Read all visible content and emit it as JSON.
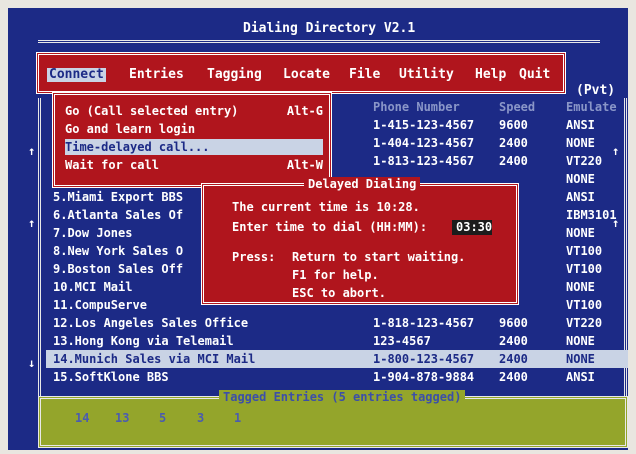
{
  "window": {
    "title": "Dialing Directory V2.1"
  },
  "menubar": {
    "items": [
      {
        "label": "Connect"
      },
      {
        "label": "Entries"
      },
      {
        "label": "Tagging"
      },
      {
        "label": "Locate"
      },
      {
        "label": "File"
      },
      {
        "label": "Utility"
      },
      {
        "label": "Help"
      },
      {
        "label": "Quit"
      }
    ]
  },
  "connect_menu": {
    "items": [
      {
        "label": "Go (Call selected entry)",
        "shortcut": "Alt-G"
      },
      {
        "label": "Go and learn login",
        "shortcut": ""
      },
      {
        "label": "Time-delayed call...",
        "shortcut": ""
      },
      {
        "label": "Wait for call",
        "shortcut": "Alt-W"
      }
    ]
  },
  "list": {
    "header": {
      "pvt": "(Pvt)",
      "phone": "Phone Number",
      "speed": "Speed",
      "emulate": "Emulate"
    },
    "rows": [
      {
        "name": "",
        "phone": "1-415-123-4567",
        "speed": "9600",
        "emu": "ANSI"
      },
      {
        "name": "",
        "phone": "1-404-123-4567",
        "speed": "2400",
        "emu": "NONE"
      },
      {
        "name": "",
        "phone": "1-813-123-4567",
        "speed": "2400",
        "emu": "VT220"
      },
      {
        "name": "",
        "phone": "",
        "speed": "",
        "emu": "NONE"
      },
      {
        "name": "5.Miami Export BBS",
        "phone": "",
        "speed": "",
        "emu": "ANSI"
      },
      {
        "name": "6.Atlanta Sales Of",
        "phone": "",
        "speed": "",
        "emu": "IBM3101"
      },
      {
        "name": "7.Dow Jones",
        "phone": "",
        "speed": "",
        "emu": "NONE"
      },
      {
        "name": "8.New York Sales O",
        "phone": "",
        "speed": "",
        "emu": "VT100"
      },
      {
        "name": "9.Boston Sales Off",
        "phone": "",
        "speed": "",
        "emu": "VT100"
      },
      {
        "name": "10.MCI Mail",
        "phone": "",
        "speed": "",
        "emu": "NONE"
      },
      {
        "name": "11.CompuServe",
        "phone": "",
        "speed": "",
        "emu": "VT100"
      },
      {
        "name": "12.Los Angeles Sales Office",
        "phone": "1-818-123-4567",
        "speed": "9600",
        "emu": "VT220"
      },
      {
        "name": "13.Hong Kong via Telemail",
        "phone": "123-4567",
        "speed": "2400",
        "emu": "NONE"
      },
      {
        "name": "14.Munich Sales via MCI Mail",
        "phone": "1-800-123-4567",
        "speed": "2400",
        "emu": "NONE"
      },
      {
        "name": "15.SoftKlone BBS",
        "phone": "1-904-878-9884",
        "speed": "2400",
        "emu": "ANSI"
      }
    ],
    "selected_index": 13
  },
  "dialog": {
    "title": "Delayed Dialing",
    "line1": "The current time is 10:28.",
    "line2": "Enter time to dial (HH:MM):",
    "input_value": "03:30",
    "press_label": "Press:",
    "hint1": "Return to start waiting.",
    "hint2": "F1 for help.",
    "hint3": "ESC to abort."
  },
  "tagged": {
    "title": "Tagged Entries (5 entries tagged)",
    "numbers": [
      "14",
      "13",
      "5",
      "3",
      "1"
    ]
  },
  "colors": {
    "screen_bg": "#1c2a86",
    "menu_bg": "#b0151d",
    "highlight": "#c9d3e5",
    "tagged_bg": "#94a52b"
  }
}
